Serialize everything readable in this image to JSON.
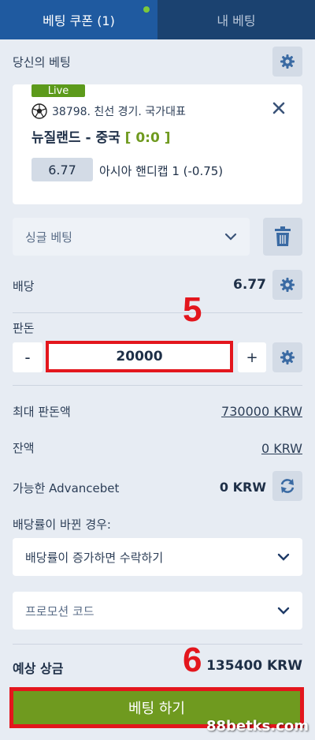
{
  "tabs": {
    "coupon": "베팅 쿠폰 (1)",
    "my_bets": "내 베팅"
  },
  "your_bet": {
    "label": "당신의 베팅"
  },
  "bet_card": {
    "live": "Live",
    "match_info": "38798. 친선 경기. 국가대표",
    "teams": "뉴질랜드 - 중국",
    "score": "[ 0:0 ]",
    "odds": "6.77",
    "market": "아시아 핸디캡 1 (-0.75)"
  },
  "bet_type": {
    "value": "싱글 베팅"
  },
  "odds_row": {
    "label": "배당",
    "value": "6.77"
  },
  "stake": {
    "label": "판돈",
    "minus": "-",
    "value": "20000",
    "plus": "+"
  },
  "max_stake": {
    "label": "최대 판돈액",
    "value": "730000 KRW"
  },
  "balance": {
    "label": "잔액",
    "value": "0 KRW"
  },
  "advancebet": {
    "label": "가능한 Advancebet",
    "value": "0 KRW"
  },
  "odds_change": {
    "label": "배당률이 바뀐 경우:",
    "value": "배당률이 증가하면 수락하기"
  },
  "promo": {
    "placeholder": "프로모션 코드"
  },
  "potential_win": {
    "label": "예상 상금",
    "value": "135400 KRW"
  },
  "place_bet": {
    "label": "베팅 하기"
  },
  "annotations": {
    "step5": "5",
    "step6": "6"
  },
  "watermark": "88betks.com",
  "colors": {
    "accent_blue": "#1f5aa0",
    "green": "#6f9a1f",
    "red_box": "#e3161d"
  }
}
